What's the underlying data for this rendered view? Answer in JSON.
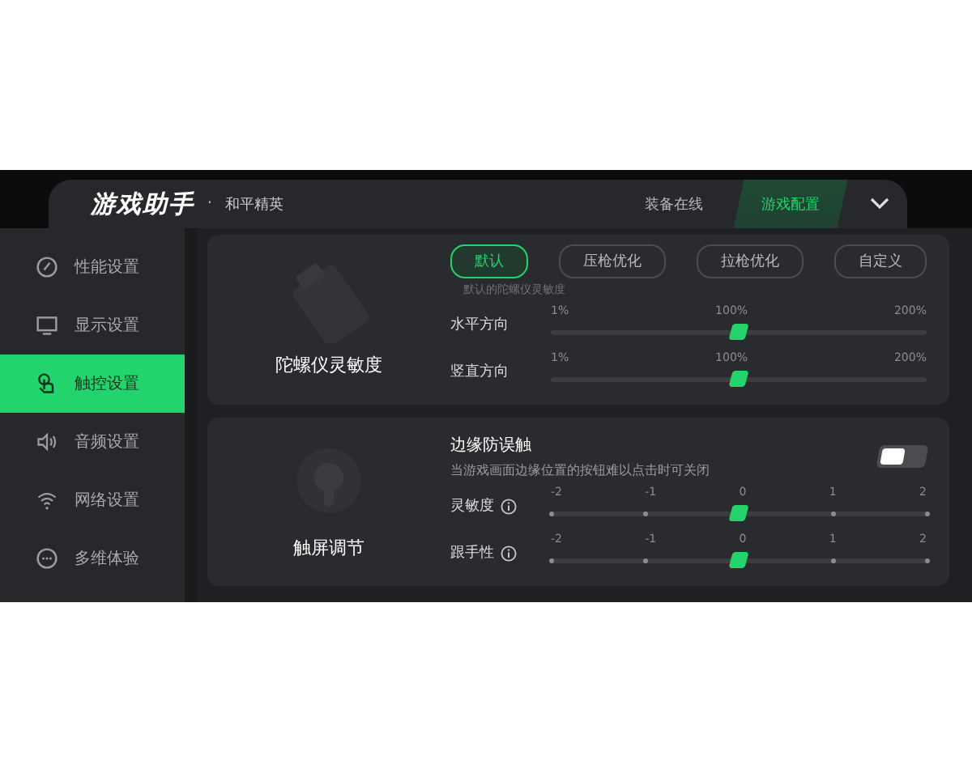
{
  "header": {
    "logo": "游戏助手",
    "separator": "·",
    "game": "和平精英",
    "tabs": [
      {
        "label": "装备在线",
        "selected": false
      },
      {
        "label": "游戏配置",
        "selected": true
      }
    ]
  },
  "sidebar": {
    "items": [
      {
        "label": "性能设置",
        "selected": false
      },
      {
        "label": "显示设置",
        "selected": false
      },
      {
        "label": "触控设置",
        "selected": true
      },
      {
        "label": "音频设置",
        "selected": false
      },
      {
        "label": "网络设置",
        "selected": false
      },
      {
        "label": "多维体验",
        "selected": false
      }
    ]
  },
  "gyro": {
    "title": "陀螺仪灵敏度",
    "presets": [
      {
        "label": "默认",
        "selected": true
      },
      {
        "label": "压枪优化",
        "selected": false
      },
      {
        "label": "拉枪优化",
        "selected": false
      },
      {
        "label": "自定义",
        "selected": false
      }
    ],
    "hint": "默认的陀螺仪灵敏度",
    "sliders": [
      {
        "label": "水平方向",
        "ticks": [
          "1%",
          "100%",
          "200%"
        ],
        "level": 0.5
      },
      {
        "label": "竖直方向",
        "ticks": [
          "1%",
          "100%",
          "200%"
        ],
        "level": 0.5
      }
    ]
  },
  "touch": {
    "title": "触屏调节",
    "edge": {
      "title": "边缘防误触",
      "description": "当游戏画面边缘位置的按钮难以点击时可关闭",
      "on": false
    },
    "sliders": [
      {
        "label": "灵敏度",
        "ticks": [
          "-2",
          "-1",
          "0",
          "1",
          "2"
        ],
        "level": 0.5
      },
      {
        "label": "跟手性",
        "ticks": [
          "-2",
          "-1",
          "0",
          "1",
          "2"
        ],
        "level": 0.5
      }
    ]
  }
}
